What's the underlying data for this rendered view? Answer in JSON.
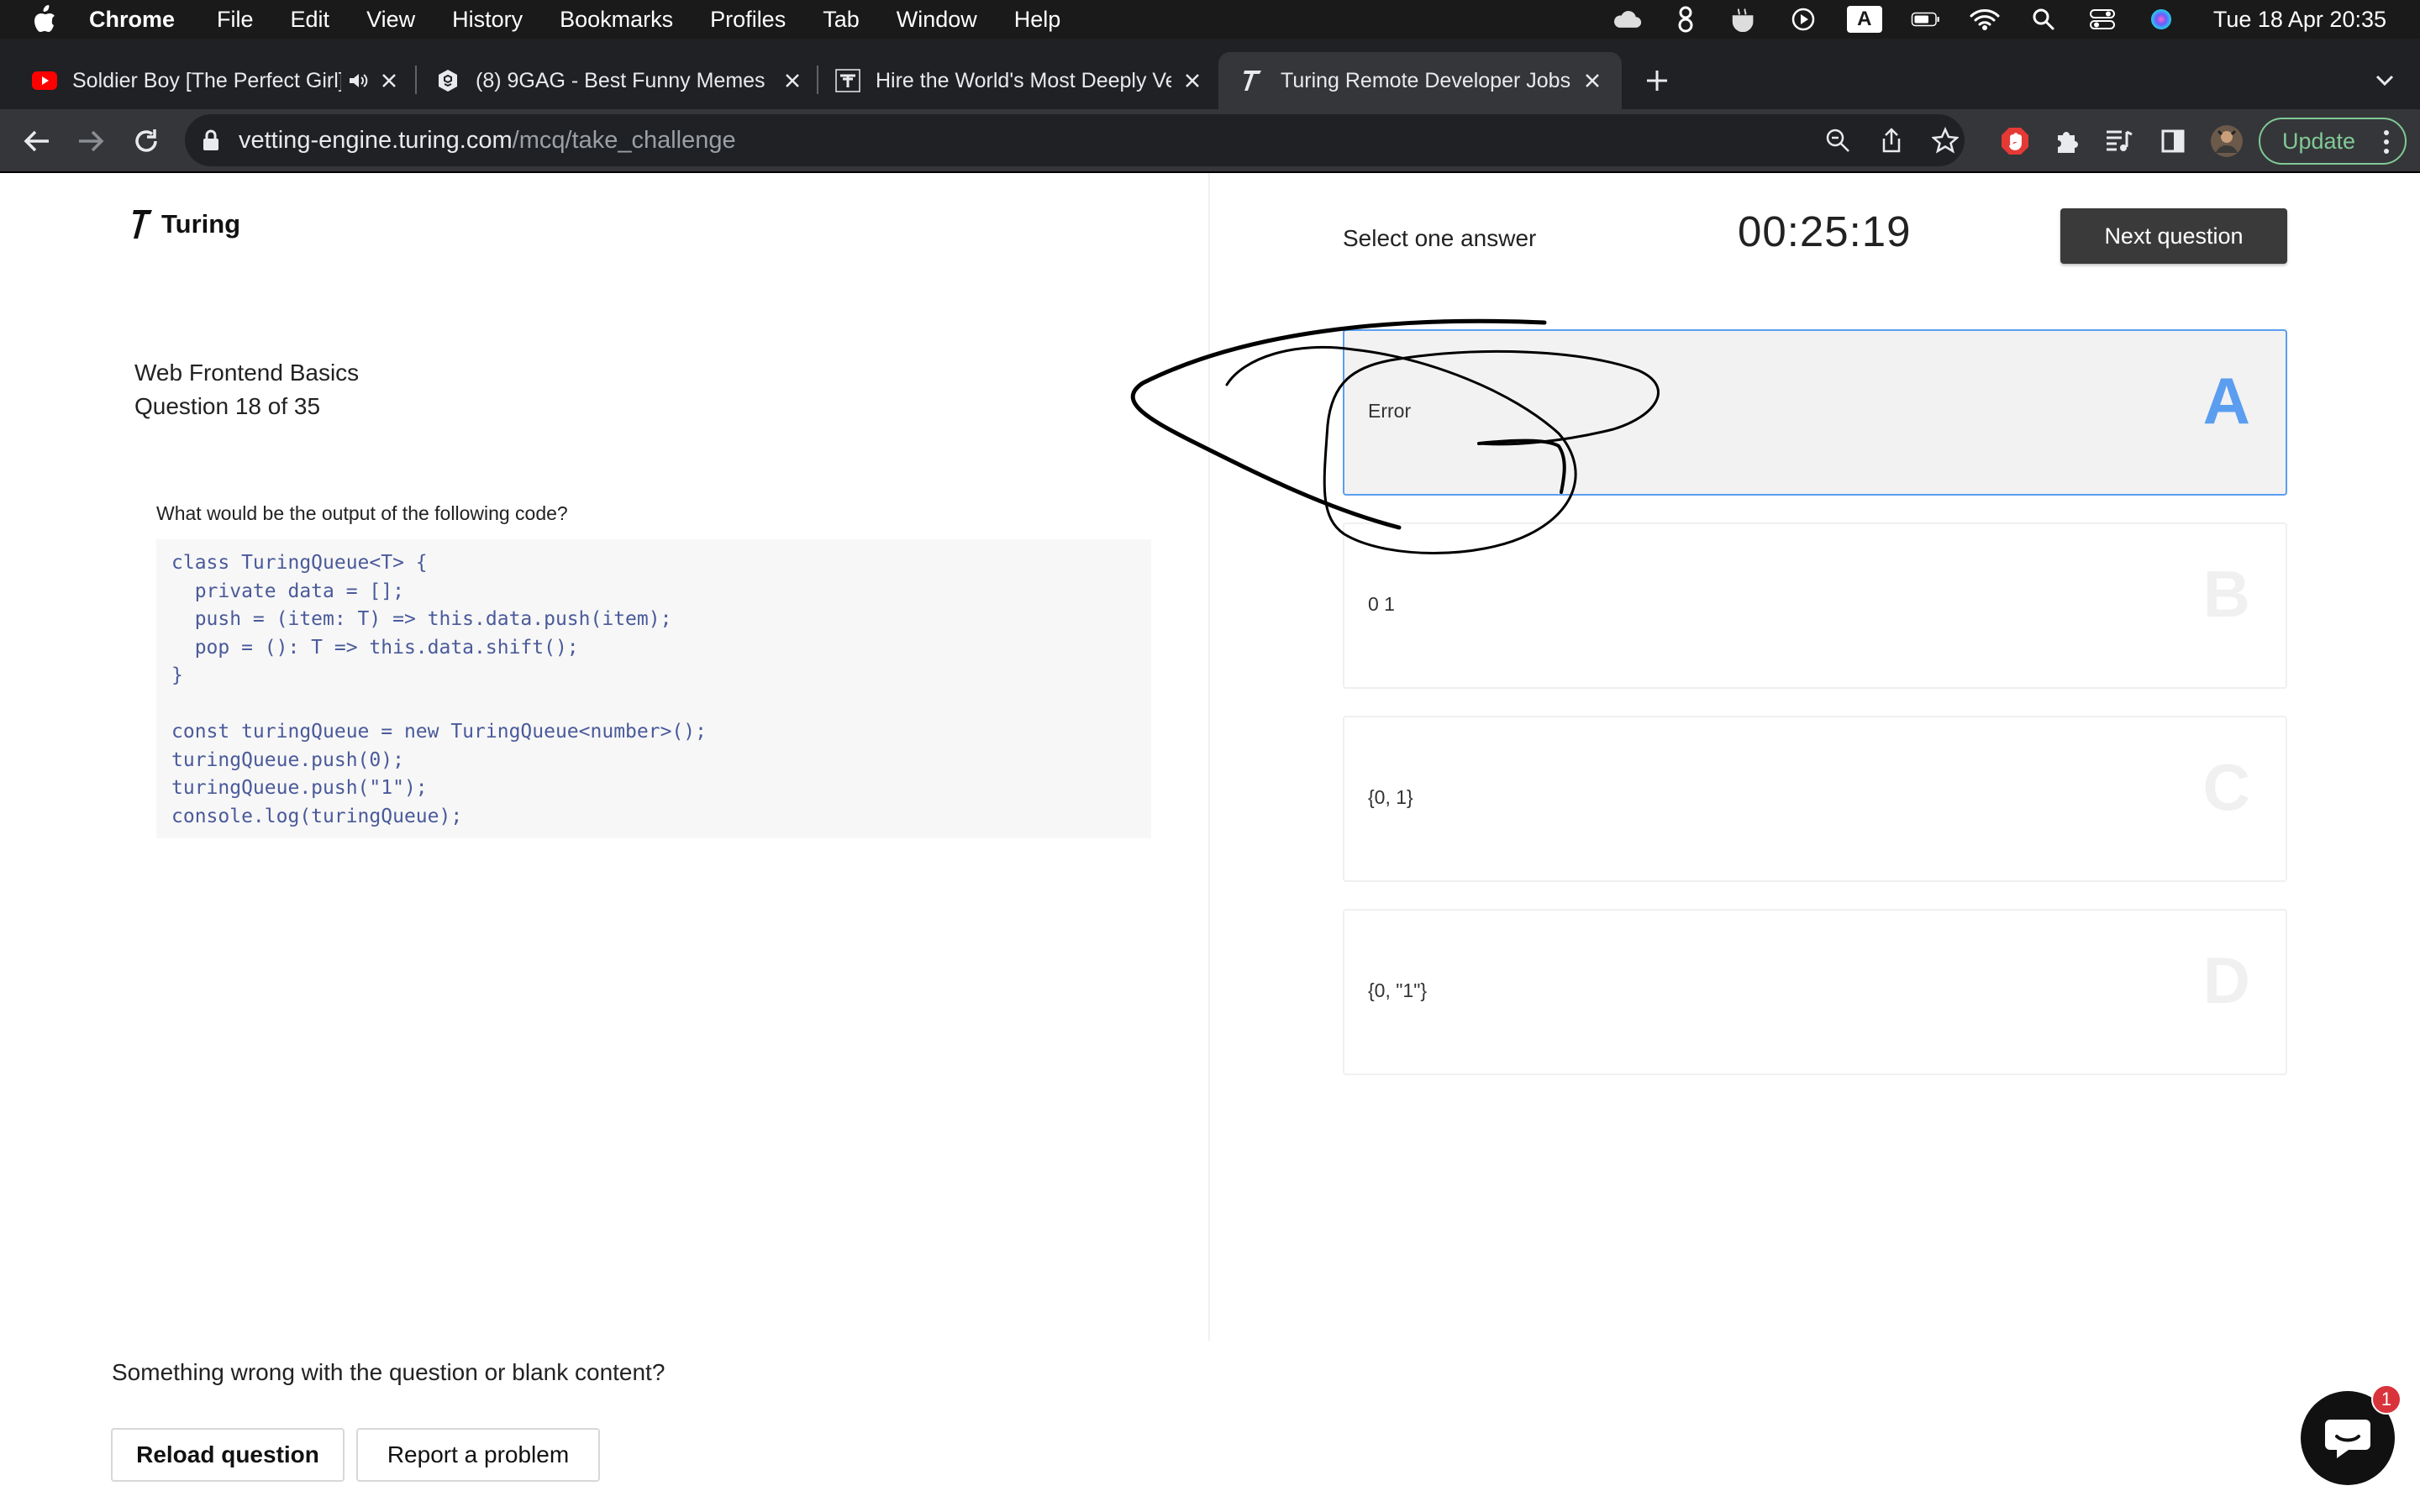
{
  "menubar": {
    "app": "Chrome",
    "items": [
      "File",
      "Edit",
      "View",
      "History",
      "Bookmarks",
      "Profiles",
      "Tab",
      "Window",
      "Help"
    ],
    "clock": "Tue 18 Apr  20:35",
    "input_source": "A"
  },
  "tabs": [
    {
      "title": "Soldier Boy [The Perfect Girl]",
      "icon": "youtube-icon"
    },
    {
      "title": "(8) 9GAG - Best Funny Memes",
      "icon": "9gag-icon"
    },
    {
      "title": "Hire the World's Most Deeply Vetted",
      "icon": "turing-icon"
    },
    {
      "title": "Turing Remote Developer Jobs",
      "icon": "turing-icon",
      "active": true
    }
  ],
  "address": {
    "host": "vetting-engine.turing.com",
    "path": "/mcq/take_challenge"
  },
  "toolbar": {
    "update_label": "Update"
  },
  "page": {
    "logo_text": "Turing",
    "test_title": "Web Frontend Basics",
    "question_counter": "Question 18 of 35",
    "prompt": "What would be the output of the following code?",
    "code_lines": [
      "class TuringQueue<T> {",
      "  private data = [];",
      "  push = (item: T) => this.data.push(item);",
      "  pop = (): T => this.data.shift();",
      "}",
      "",
      "const turingQueue = new TuringQueue<number>();",
      "turingQueue.push(0);",
      "turingQueue.push(\"1\");",
      "console.log(turingQueue);"
    ],
    "select_label": "Select one answer",
    "timer": "00:25:19",
    "next_label": "Next question",
    "options": [
      {
        "letter": "A",
        "text": "Error",
        "selected": true
      },
      {
        "letter": "B",
        "text": "0 1",
        "selected": false
      },
      {
        "letter": "C",
        "text": "{0, 1}",
        "selected": false
      },
      {
        "letter": "D",
        "text": "{0, \"1\"}",
        "selected": false
      }
    ],
    "problem_text": "Something wrong with the question or blank content?",
    "reload_label": "Reload question",
    "report_label": "Report a problem",
    "chat_badge": "1"
  },
  "colors": {
    "accent": "#5b9ef0",
    "update_green": "#81c995",
    "badge_red": "#d9343b"
  }
}
